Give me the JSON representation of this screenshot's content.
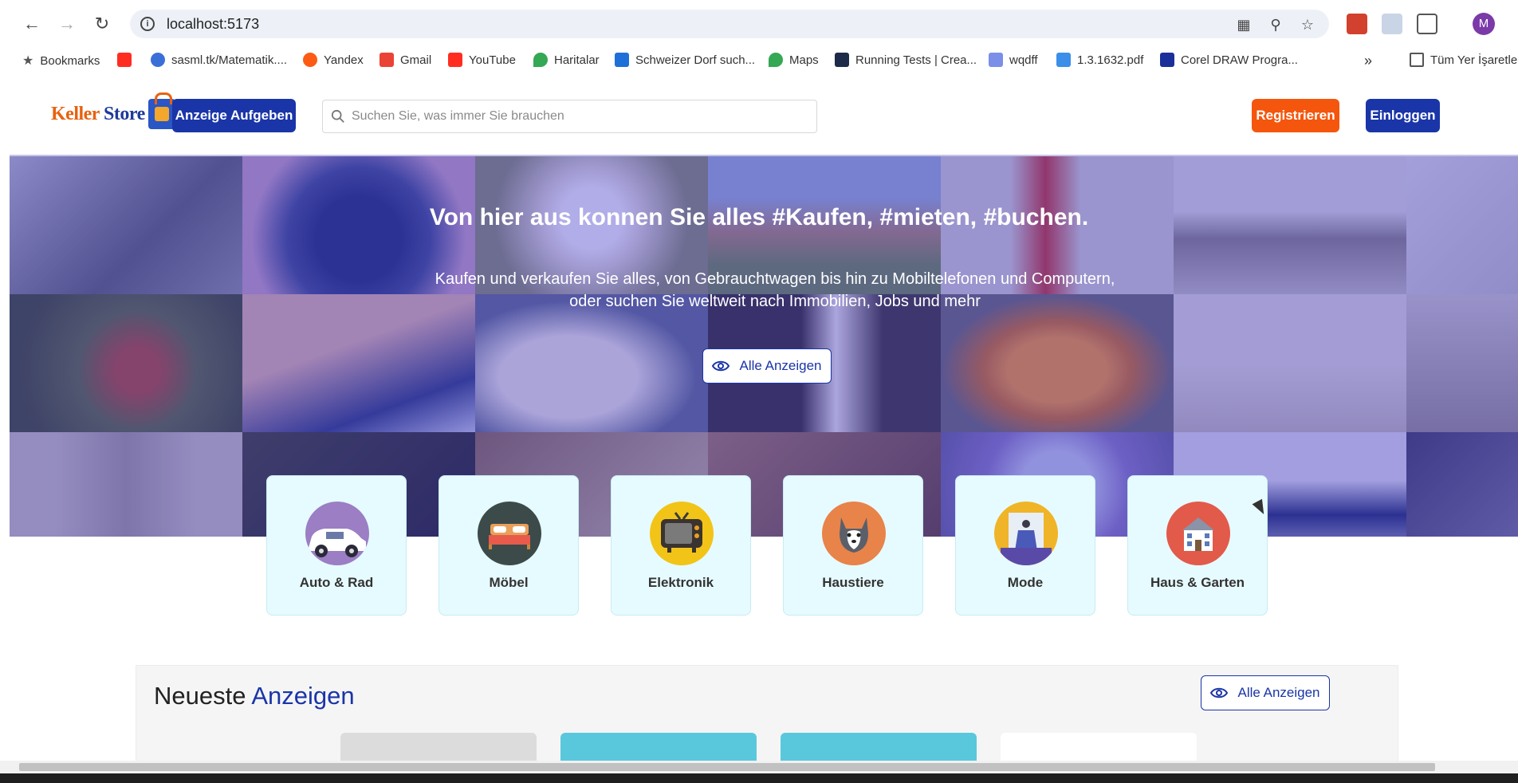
{
  "browser": {
    "url": "localhost:5173",
    "bookmarks": [
      {
        "label": "Bookmarks",
        "icon": "star-icon"
      },
      {
        "label": "",
        "icon": "youtube-icon"
      },
      {
        "label": "sasml.tk/Matematik....",
        "icon": "site-icon"
      },
      {
        "label": "Yandex",
        "icon": "yandex-icon"
      },
      {
        "label": "Gmail",
        "icon": "gmail-icon"
      },
      {
        "label": "YouTube",
        "icon": "youtube-icon"
      },
      {
        "label": "Haritalar",
        "icon": "maps-icon"
      },
      {
        "label": "Schweizer Dorf such...",
        "icon": "site-icon"
      },
      {
        "label": "Maps",
        "icon": "maps-icon"
      },
      {
        "label": "Running Tests | Crea...",
        "icon": "site-icon"
      },
      {
        "label": "wqdff",
        "icon": "site-icon"
      },
      {
        "label": "1.3.1632.pdf",
        "icon": "pdf-icon"
      },
      {
        "label": "Corel DRAW Progra...",
        "icon": "site-icon"
      },
      {
        "label": "Tüm Yer İşaretle",
        "icon": "folder-icon"
      }
    ],
    "profile_initial": "M"
  },
  "header": {
    "logo_text_1": "Keller",
    "logo_text_2": "Store",
    "post_ad_button": "Anzeige Aufgeben",
    "search_placeholder": "Suchen Sie, was immer Sie brauchen",
    "register_button": "Registrieren",
    "login_button": "Einloggen"
  },
  "hero": {
    "title": "Von hier aus konnen Sie alles #Kaufen, #mieten, #buchen.",
    "subtitle": "Kaufen und verkaufen Sie alles, von Gebrauchtwagen bis hin zu Mobiltelefonen und Computern, oder suchen Sie weltweit nach Immobilien, Jobs und mehr",
    "button": "Alle Anzeigen"
  },
  "categories": [
    {
      "label": "Auto & Rad",
      "icon": "car-icon"
    },
    {
      "label": "Möbel",
      "icon": "bed-icon"
    },
    {
      "label": "Elektronik",
      "icon": "tv-icon"
    },
    {
      "label": "Haustiere",
      "icon": "dog-icon"
    },
    {
      "label": "Mode",
      "icon": "fashion-icon"
    },
    {
      "label": "Haus & Garten",
      "icon": "house-icon"
    }
  ],
  "latest": {
    "title_part1": "Neueste",
    "title_part2": "Anzeigen",
    "button": "Alle Anzeigen"
  },
  "colors": {
    "primary": "#1a35a8",
    "accent": "#f4560d",
    "category_bg": "#e6fbff"
  }
}
